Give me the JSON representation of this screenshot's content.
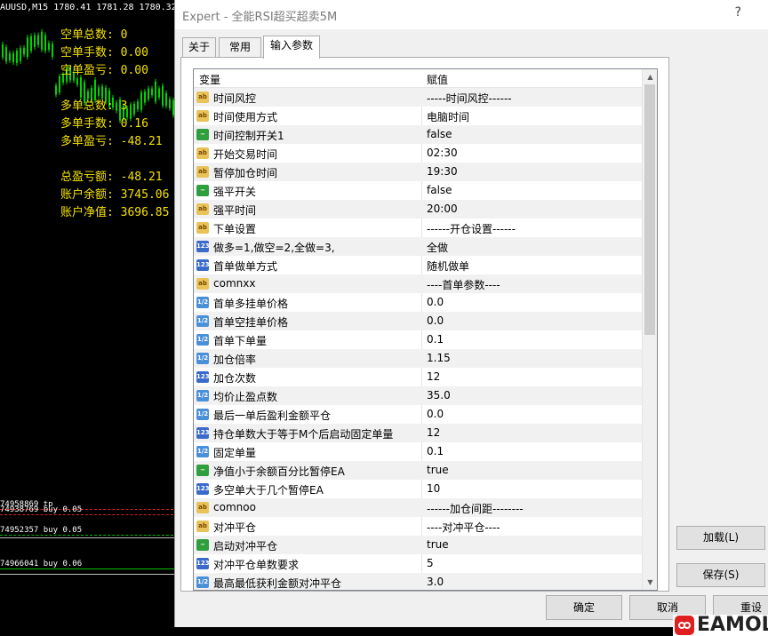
{
  "chart": {
    "title": "AUUSD,M15  1780.41 1781.28 1780.32 1781.2",
    "stats": [
      {
        "label": "空单总数: 0"
      },
      {
        "label": "空单手数: 0.00"
      },
      {
        "label": "空单盈亏: 0.00"
      },
      {
        "label": "多单总数: 3"
      },
      {
        "label": "多单手数: 0.16"
      },
      {
        "label": "多单盈亏: -48.21"
      },
      {
        "label": "总盈亏额: -48.21"
      },
      {
        "label": "账户余额: 3745.06"
      },
      {
        "label": "账户净值: 3696.85"
      }
    ],
    "orders": [
      {
        "label": "74958869 tp"
      },
      {
        "label": "74938769 buy 0.05"
      },
      {
        "label": "74952357 buy 0.05"
      },
      {
        "label": "74966041 buy 0.06"
      }
    ],
    "colors": {
      "stat_text": "#f4e200",
      "candle": "#00d400"
    }
  },
  "dialog": {
    "title": "Expert - 全能RSI超买超卖5M",
    "help": "?",
    "tabs": [
      {
        "label": "关于"
      },
      {
        "label": "常用"
      },
      {
        "label": "输入参数"
      }
    ],
    "columns": {
      "name": "变量",
      "value": "赋值"
    },
    "params": [
      {
        "icon": "ab",
        "name": "时间风控",
        "value": "-----时间风控------"
      },
      {
        "icon": "ab",
        "name": "时间使用方式",
        "value": "电脑时间"
      },
      {
        "icon": "bool",
        "name": "时间控制开关1",
        "value": "false"
      },
      {
        "icon": "ab",
        "name": "开始交易时间",
        "value": "02:30"
      },
      {
        "icon": "ab",
        "name": "暂停加仓时间",
        "value": "19:30"
      },
      {
        "icon": "bool",
        "name": "强平开关",
        "value": "false"
      },
      {
        "icon": "ab",
        "name": "强平时间",
        "value": "20:00"
      },
      {
        "icon": "ab",
        "name": "下单设置",
        "value": "------开仓设置------"
      },
      {
        "icon": "num",
        "name": "做多=1,做空=2,全做=3,",
        "value": "全做"
      },
      {
        "icon": "num",
        "name": "首单做单方式",
        "value": "随机做单"
      },
      {
        "icon": "ab",
        "name": "comnxx",
        "value": "----首单参数----"
      },
      {
        "icon": "dbl",
        "name": "首单多挂单价格",
        "value": "0.0"
      },
      {
        "icon": "dbl",
        "name": "首单空挂单价格",
        "value": "0.0"
      },
      {
        "icon": "dbl",
        "name": "首单下单量",
        "value": "0.1"
      },
      {
        "icon": "dbl",
        "name": "加仓倍率",
        "value": "1.15"
      },
      {
        "icon": "num",
        "name": "加仓次数",
        "value": "12"
      },
      {
        "icon": "dbl",
        "name": "均价止盈点数",
        "value": "35.0"
      },
      {
        "icon": "dbl",
        "name": "最后一单后盈利金额平仓",
        "value": "0.0"
      },
      {
        "icon": "num",
        "name": "持仓单数大于等于M个后启动固定单量",
        "value": "12"
      },
      {
        "icon": "dbl",
        "name": "固定单量",
        "value": "0.1"
      },
      {
        "icon": "bool",
        "name": "净值小于余额百分比暂停EA",
        "value": "true"
      },
      {
        "icon": "num",
        "name": "多空单大于几个暂停EA",
        "value": "10"
      },
      {
        "icon": "ab",
        "name": "comnoo",
        "value": "------加仓间距--------"
      },
      {
        "icon": "ab",
        "name": "对冲平仓",
        "value": "----对冲平仓----"
      },
      {
        "icon": "bool",
        "name": "启动对冲平仓",
        "value": "true"
      },
      {
        "icon": "num",
        "name": "对冲平仓单数要求",
        "value": "5"
      },
      {
        "icon": "dbl",
        "name": "最高最低获利金额对冲平仓",
        "value": "3.0"
      }
    ],
    "buttons": {
      "load": "加载(L)",
      "save": "保存(S)",
      "ok": "确定",
      "cancel": "取消",
      "reset": "重设"
    }
  },
  "watermark": {
    "text": "EAMOL"
  }
}
